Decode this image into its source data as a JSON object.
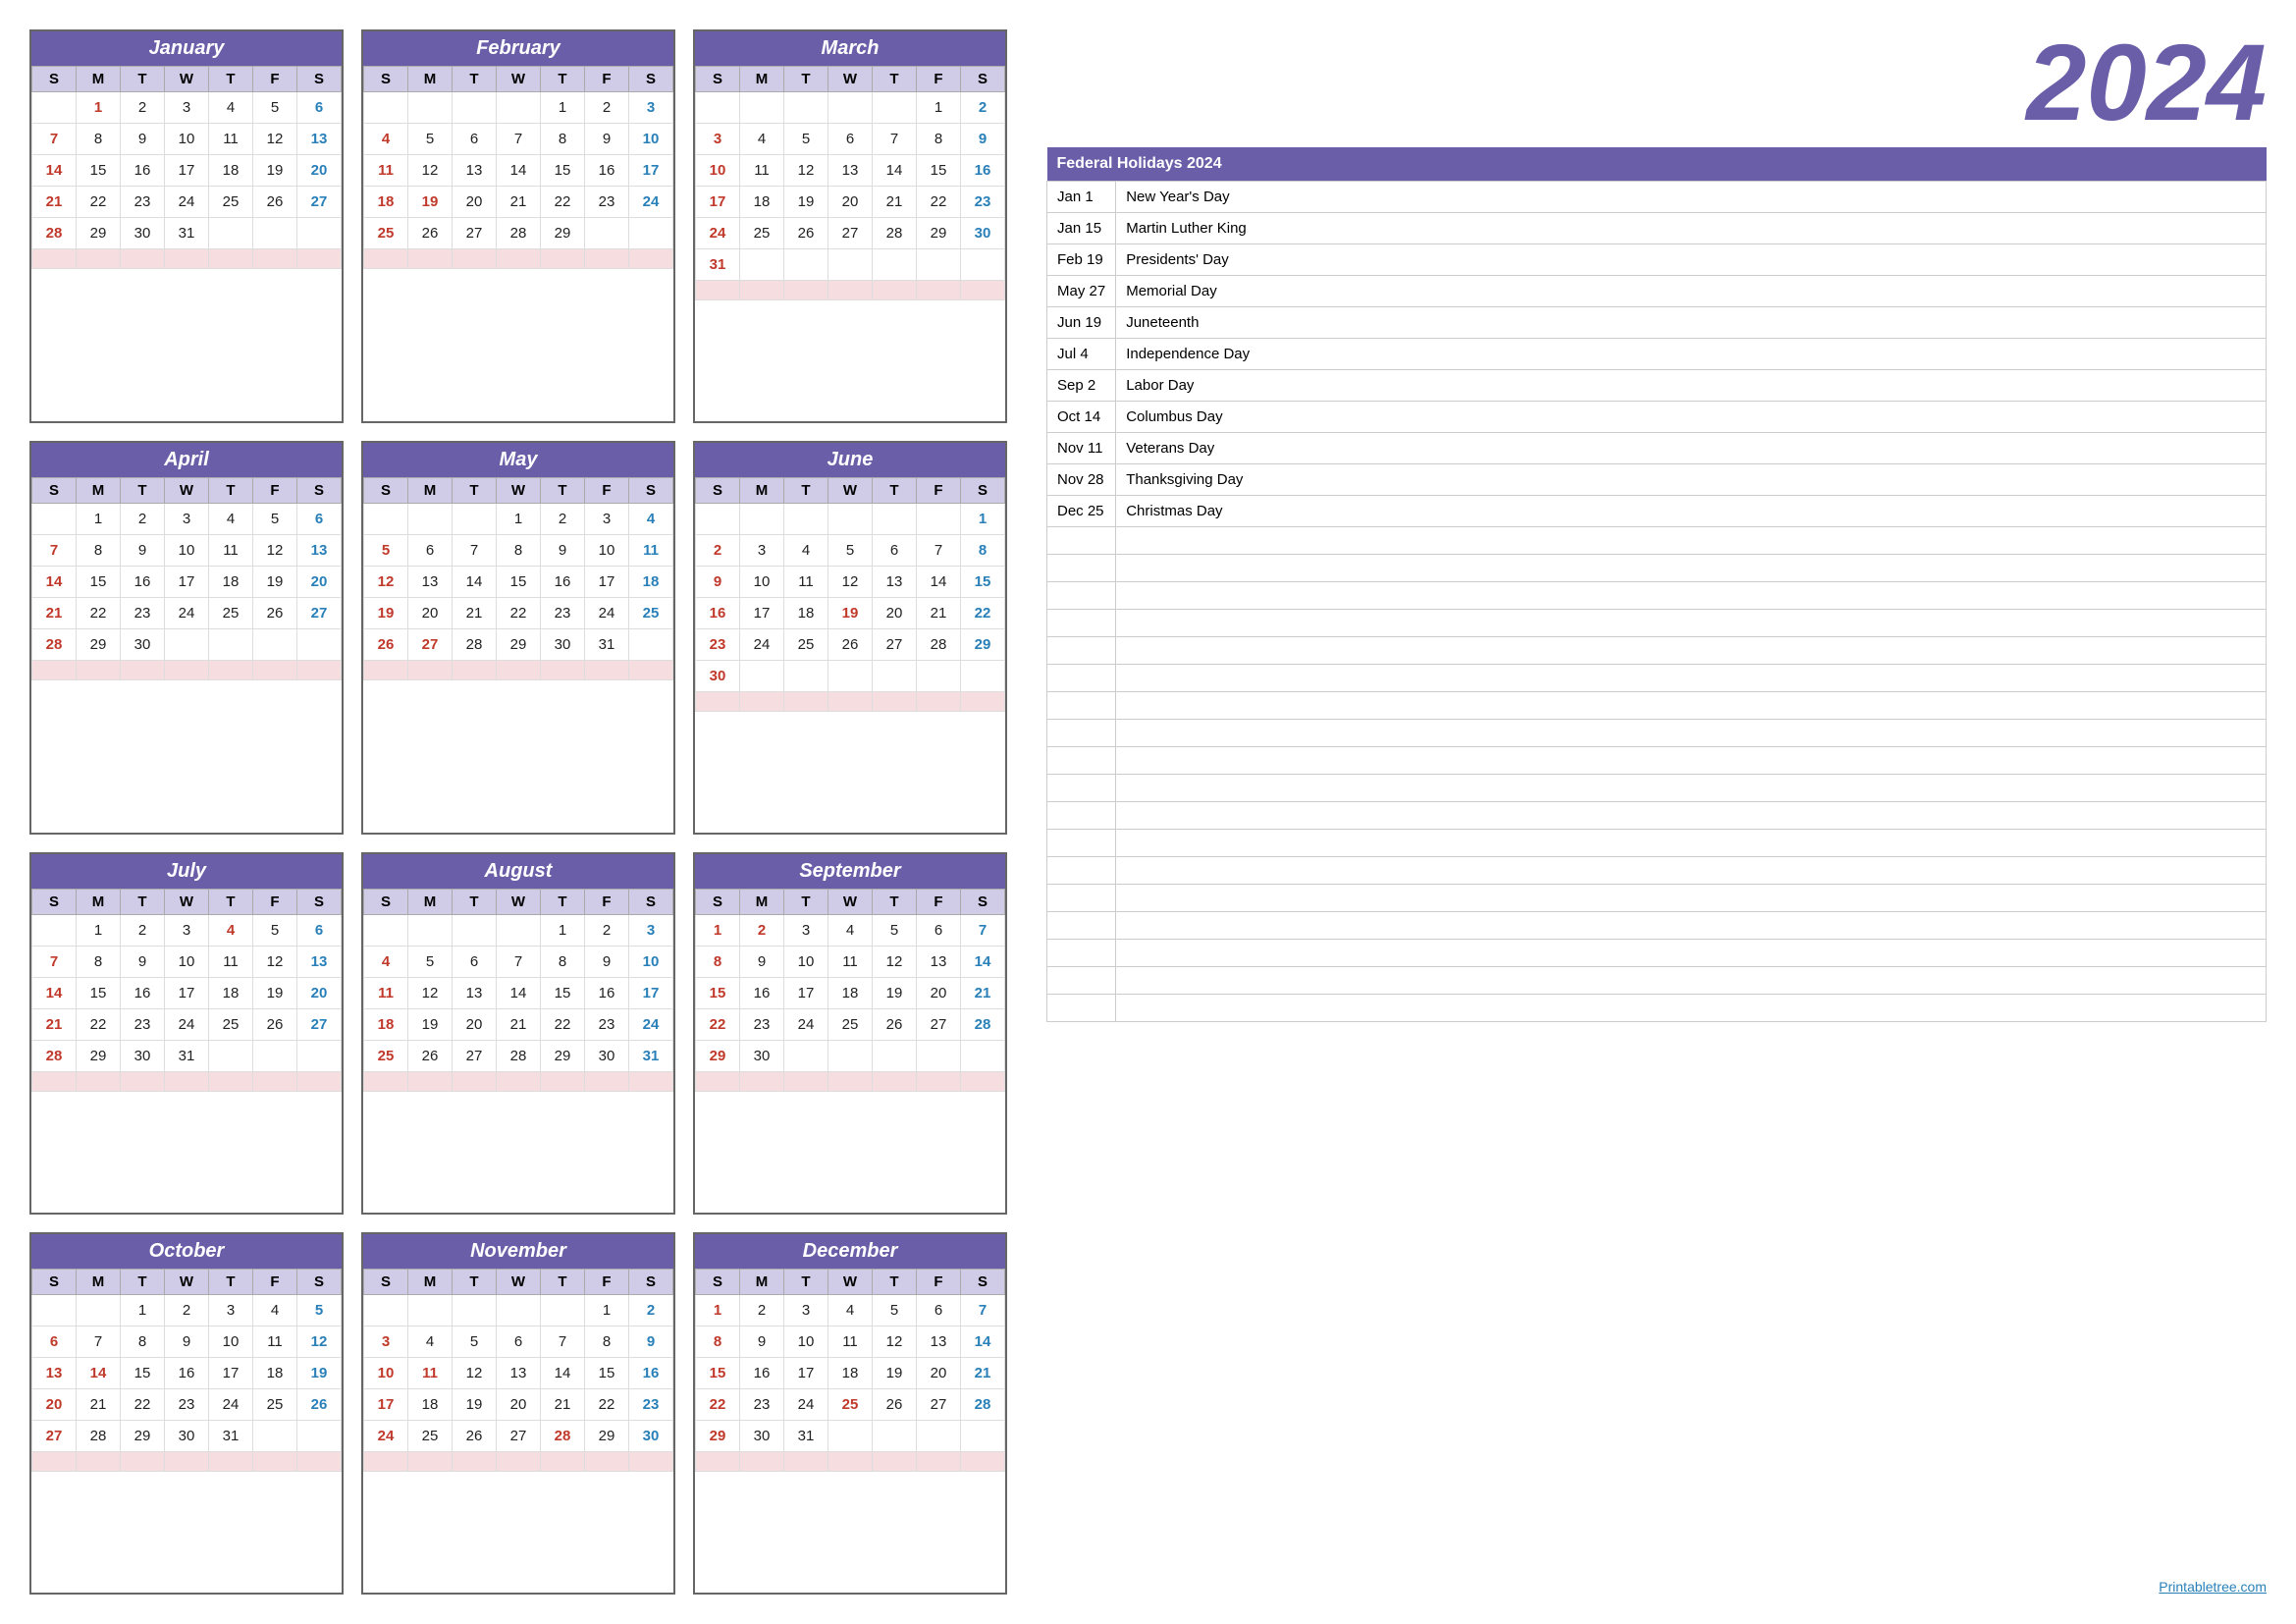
{
  "year": "2024",
  "holidays_header": "Federal Holidays 2024",
  "holidays": [
    {
      "date": "Jan 1",
      "name": "New Year's Day"
    },
    {
      "date": "Jan 15",
      "name": "Martin Luther King"
    },
    {
      "date": "Feb 19",
      "name": "Presidents' Day"
    },
    {
      "date": "May 27",
      "name": "Memorial Day"
    },
    {
      "date": "Jun 19",
      "name": "Juneteenth"
    },
    {
      "date": "Jul 4",
      "name": "Independence Day"
    },
    {
      "date": "Sep 2",
      "name": "Labor Day"
    },
    {
      "date": "Oct 14",
      "name": "Columbus Day"
    },
    {
      "date": "Nov 11",
      "name": "Veterans Day"
    },
    {
      "date": "Nov 28",
      "name": "Thanksgiving Day"
    },
    {
      "date": "Dec 25",
      "name": "Christmas Day"
    }
  ],
  "footer_link": "Printabletree.com",
  "months": [
    {
      "name": "January",
      "weeks": [
        [
          null,
          1,
          2,
          3,
          4,
          5,
          6
        ],
        [
          7,
          8,
          9,
          10,
          11,
          12,
          13
        ],
        [
          14,
          15,
          16,
          17,
          18,
          19,
          20
        ],
        [
          21,
          22,
          23,
          24,
          25,
          26,
          27
        ],
        [
          28,
          29,
          30,
          31,
          null,
          null,
          null
        ]
      ],
      "holidays": [
        1
      ]
    },
    {
      "name": "February",
      "weeks": [
        [
          null,
          null,
          null,
          null,
          1,
          2,
          3
        ],
        [
          4,
          5,
          6,
          7,
          8,
          9,
          10
        ],
        [
          11,
          12,
          13,
          14,
          15,
          16,
          17
        ],
        [
          18,
          19,
          20,
          21,
          22,
          23,
          24
        ],
        [
          25,
          26,
          27,
          28,
          29,
          null,
          null
        ]
      ],
      "holidays": [
        19
      ]
    },
    {
      "name": "March",
      "weeks": [
        [
          null,
          null,
          null,
          null,
          null,
          1,
          2
        ],
        [
          3,
          4,
          5,
          6,
          7,
          8,
          9
        ],
        [
          10,
          11,
          12,
          13,
          14,
          15,
          16
        ],
        [
          17,
          18,
          19,
          20,
          21,
          22,
          23
        ],
        [
          24,
          25,
          26,
          27,
          28,
          29,
          30
        ],
        [
          31,
          null,
          null,
          null,
          null,
          null,
          null
        ]
      ],
      "holidays": []
    },
    {
      "name": "April",
      "weeks": [
        [
          null,
          1,
          2,
          3,
          4,
          5,
          6
        ],
        [
          7,
          8,
          9,
          10,
          11,
          12,
          13
        ],
        [
          14,
          15,
          16,
          17,
          18,
          19,
          20
        ],
        [
          21,
          22,
          23,
          24,
          25,
          26,
          27
        ],
        [
          28,
          29,
          30,
          null,
          null,
          null,
          null
        ]
      ],
      "holidays": []
    },
    {
      "name": "May",
      "weeks": [
        [
          null,
          null,
          null,
          1,
          2,
          3,
          4
        ],
        [
          5,
          6,
          7,
          8,
          9,
          10,
          11
        ],
        [
          12,
          13,
          14,
          15,
          16,
          17,
          18
        ],
        [
          19,
          20,
          21,
          22,
          23,
          24,
          25
        ],
        [
          26,
          27,
          28,
          29,
          30,
          31,
          null
        ]
      ],
      "holidays": [
        27
      ]
    },
    {
      "name": "June",
      "weeks": [
        [
          null,
          null,
          null,
          null,
          null,
          null,
          1
        ],
        [
          2,
          3,
          4,
          5,
          6,
          7,
          8
        ],
        [
          9,
          10,
          11,
          12,
          13,
          14,
          15
        ],
        [
          16,
          17,
          18,
          19,
          20,
          21,
          22
        ],
        [
          23,
          24,
          25,
          26,
          27,
          28,
          29
        ],
        [
          30,
          null,
          null,
          null,
          null,
          null,
          null
        ]
      ],
      "holidays": [
        19
      ]
    },
    {
      "name": "July",
      "weeks": [
        [
          null,
          1,
          2,
          3,
          4,
          5,
          6
        ],
        [
          7,
          8,
          9,
          10,
          11,
          12,
          13
        ],
        [
          14,
          15,
          16,
          17,
          18,
          19,
          20
        ],
        [
          21,
          22,
          23,
          24,
          25,
          26,
          27
        ],
        [
          28,
          29,
          30,
          31,
          null,
          null,
          null
        ]
      ],
      "holidays": [
        4
      ]
    },
    {
      "name": "August",
      "weeks": [
        [
          null,
          null,
          null,
          null,
          1,
          2,
          3
        ],
        [
          4,
          5,
          6,
          7,
          8,
          9,
          10
        ],
        [
          11,
          12,
          13,
          14,
          15,
          16,
          17
        ],
        [
          18,
          19,
          20,
          21,
          22,
          23,
          24
        ],
        [
          25,
          26,
          27,
          28,
          29,
          30,
          31
        ]
      ],
      "holidays": []
    },
    {
      "name": "September",
      "weeks": [
        [
          1,
          2,
          3,
          4,
          5,
          6,
          7
        ],
        [
          8,
          9,
          10,
          11,
          12,
          13,
          14
        ],
        [
          15,
          16,
          17,
          18,
          19,
          20,
          21
        ],
        [
          22,
          23,
          24,
          25,
          26,
          27,
          28
        ],
        [
          29,
          30,
          null,
          null,
          null,
          null,
          null
        ]
      ],
      "holidays": [
        2
      ]
    },
    {
      "name": "October",
      "weeks": [
        [
          null,
          null,
          1,
          2,
          3,
          4,
          5
        ],
        [
          6,
          7,
          8,
          9,
          10,
          11,
          12
        ],
        [
          13,
          14,
          15,
          16,
          17,
          18,
          19
        ],
        [
          20,
          21,
          22,
          23,
          24,
          25,
          26
        ],
        [
          27,
          28,
          29,
          30,
          31,
          null,
          null
        ]
      ],
      "holidays": [
        14
      ]
    },
    {
      "name": "November",
      "weeks": [
        [
          null,
          null,
          null,
          null,
          null,
          1,
          2
        ],
        [
          3,
          4,
          5,
          6,
          7,
          8,
          9
        ],
        [
          10,
          11,
          12,
          13,
          14,
          15,
          16
        ],
        [
          17,
          18,
          19,
          20,
          21,
          22,
          23
        ],
        [
          24,
          25,
          26,
          27,
          28,
          29,
          30
        ]
      ],
      "holidays": [
        11,
        28
      ]
    },
    {
      "name": "December",
      "weeks": [
        [
          1,
          2,
          3,
          4,
          5,
          6,
          7
        ],
        [
          8,
          9,
          10,
          11,
          12,
          13,
          14
        ],
        [
          15,
          16,
          17,
          18,
          19,
          20,
          21
        ],
        [
          22,
          23,
          24,
          25,
          26,
          27,
          28
        ],
        [
          29,
          30,
          31,
          null,
          null,
          null,
          null
        ]
      ],
      "holidays": [
        25
      ]
    }
  ],
  "day_headers": [
    "S",
    "M",
    "T",
    "W",
    "T",
    "F",
    "S"
  ]
}
